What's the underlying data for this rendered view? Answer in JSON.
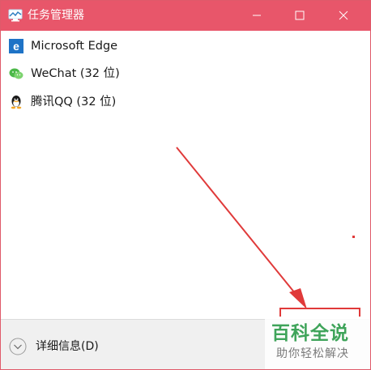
{
  "window": {
    "title": "任务管理器",
    "accent_color": "#e8566a",
    "icons": {
      "app": "task-manager-icon",
      "minimize": "minimize-icon",
      "maximize": "maximize-icon",
      "close": "close-icon"
    }
  },
  "apps": [
    {
      "name": "Microsoft Edge",
      "icon": "edge-icon"
    },
    {
      "name": "WeChat (32 位)",
      "icon": "wechat-icon"
    },
    {
      "name": "腾讯QQ (32 位)",
      "icon": "qq-icon"
    }
  ],
  "footer": {
    "details_label": "详细信息(D)",
    "icon": "chevron-down-icon"
  },
  "watermark": {
    "title": "百科全说",
    "subtitle": "助你轻松解决"
  }
}
